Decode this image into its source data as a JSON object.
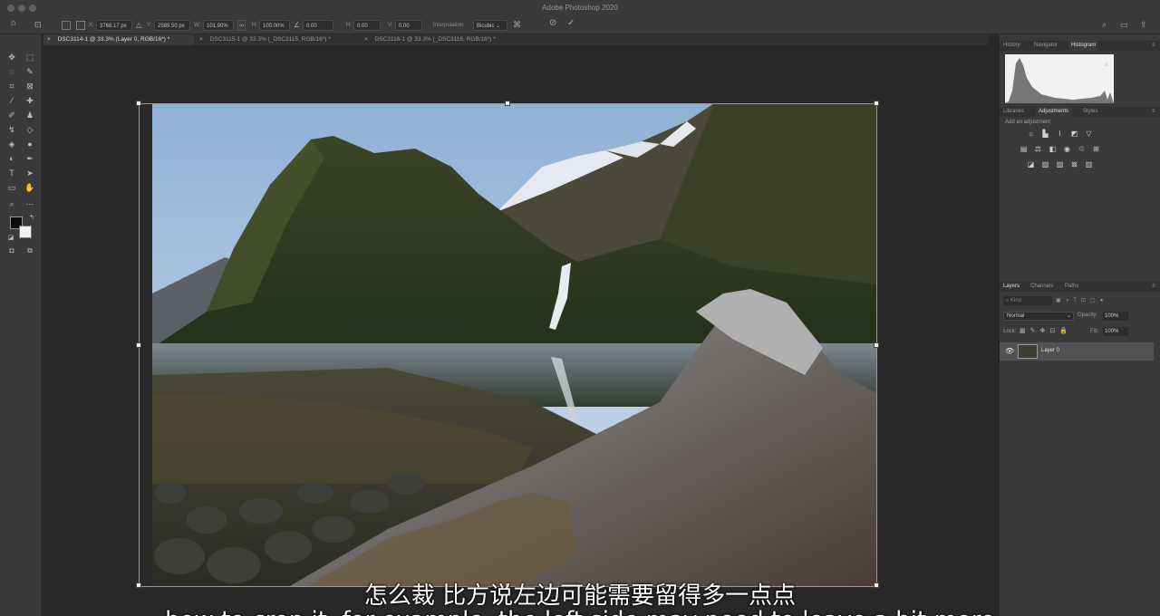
{
  "window": {
    "title": "Adobe Photoshop 2020"
  },
  "options_bar": {
    "x_label": "X:",
    "x_value": "3768.17 px",
    "y_label": "Y:",
    "y_value": "2589.50 px",
    "w_label": "W:",
    "w_value": "101.90%",
    "h_label": "H:",
    "h_value": "100.00%",
    "angle_value": "0.00",
    "hskew_label": "H:",
    "hskew_value": "0.00",
    "vskew_label": "V:",
    "vskew_value": "0.00",
    "interpolation_label": "Interpolation:",
    "interpolation_value": "Bicubic"
  },
  "document_tabs": [
    {
      "label": "DSC3114-1 @ 33.3% (Layer 0, RGB/16*) *"
    },
    {
      "label": "DSC3115-1 @ 33.3% (_DSC3115, RGB/16*) *"
    },
    {
      "label": "DSC3116-1 @ 33.3% (_DSC3116, RGB/16*) *"
    }
  ],
  "panel_top": {
    "tabs": [
      "History",
      "Navigator",
      "Histogram"
    ]
  },
  "panel_mid": {
    "tabs": [
      "Libraries",
      "Adjustments",
      "Styles"
    ],
    "add_adjustment": "Add an adjustment"
  },
  "layers_panel": {
    "tabs": [
      "Layers",
      "Channels",
      "Paths"
    ],
    "kind_label": "Kind",
    "blend_mode": "Normal",
    "opacity_label": "Opacity:",
    "opacity_value": "100%",
    "lock_label": "Lock:",
    "fill_label": "Fill:",
    "fill_value": "100%",
    "layers": [
      {
        "name": "Layer 0"
      }
    ]
  },
  "subtitles": {
    "line1": "怎么裁 比方说左边可能需要留得多一点点",
    "line2": "how to crop it, for example, the left side may need to leave a bit more"
  },
  "colors": {
    "chrome": "#3a3a3a",
    "canvas_bg": "#282828",
    "panel_dark": "#323232"
  }
}
